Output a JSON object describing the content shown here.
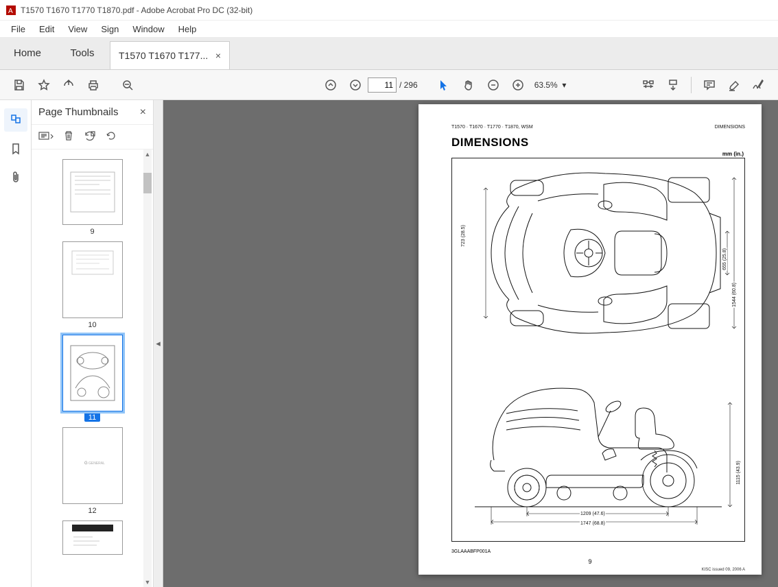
{
  "window": {
    "title": "T1570 T1670 T1770 T1870.pdf - Adobe Acrobat Pro DC (32-bit)"
  },
  "menu": {
    "file": "File",
    "edit": "Edit",
    "view": "View",
    "sign": "Sign",
    "window": "Window",
    "help": "Help"
  },
  "tabs": {
    "home": "Home",
    "tools": "Tools",
    "doc": "T1570 T1670 T177..."
  },
  "toolbar": {
    "page_current": "11",
    "page_total": "/ 296",
    "zoom": "63.5%"
  },
  "thumbs": {
    "title": "Page Thumbnails",
    "items": [
      "9",
      "10",
      "11",
      "12"
    ]
  },
  "document": {
    "header_left": "T1570 · T1670 · T1770 · T1870, WSM",
    "header_right": "DIMENSIONS",
    "title": "DIMENSIONS",
    "units": "mm (in.)",
    "fig_ref": "3GLAAABFP001A",
    "page_number": "9",
    "footer": "KISC issued 09, 2006 A",
    "dimensions": {
      "top_view": {
        "track_width": "723 (28.5)",
        "seat_width": "655 (25.8)",
        "overall_width": "1544 (60.8)"
      },
      "side_view": {
        "wheelbase": "1209 (47.6)",
        "overall_length": "1747 (68.8)",
        "overall_height": "1115 (43.9)"
      }
    }
  }
}
